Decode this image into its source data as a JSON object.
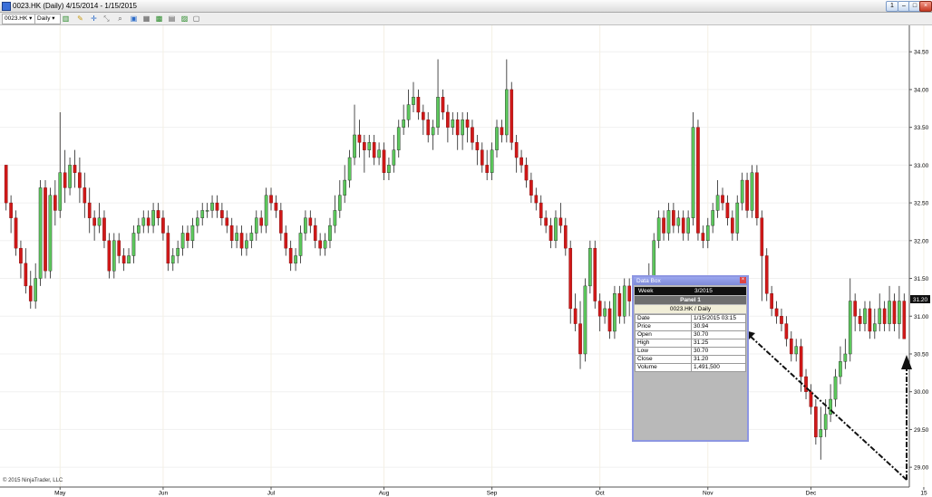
{
  "window": {
    "title": "0023.HK (Daily)  4/15/2014 - 1/15/2015",
    "buttons": [
      "1",
      "–",
      "□",
      "×"
    ]
  },
  "toolbar": {
    "instrument": "0023.HK",
    "interval": "Daily"
  },
  "copyright": "© 2015 NinjaTrader, LLC",
  "chart_data": {
    "type": "candlestick",
    "instrument": "0023.HK",
    "interval": "Daily",
    "ylim": [
      28.75,
      34.85
    ],
    "y_ticks": [
      "34.50",
      "34.00",
      "33.50",
      "33.00",
      "32.50",
      "32.00",
      "31.50",
      "31.00",
      "30.50",
      "30.00",
      "29.50",
      "29.00"
    ],
    "x_ticks": [
      "May",
      "Jun",
      "Jul",
      "Aug",
      "Sep",
      "Oct",
      "Nov",
      "Dec",
      "15"
    ],
    "last_price": "31.20",
    "colors": {
      "up": "#5cc85c",
      "down": "#d01818",
      "wick": "#222222"
    },
    "candles": [
      [
        33.0,
        32.5,
        33.0,
        32.4
      ],
      [
        32.5,
        32.3,
        32.6,
        32.1
      ],
      [
        32.3,
        31.9,
        32.4,
        31.8
      ],
      [
        31.9,
        31.7,
        32.0,
        31.5
      ],
      [
        31.7,
        31.4,
        31.9,
        31.3
      ],
      [
        31.4,
        31.2,
        31.6,
        31.1
      ],
      [
        31.2,
        31.5,
        31.7,
        31.1
      ],
      [
        31.5,
        32.7,
        32.8,
        31.4
      ],
      [
        32.7,
        31.6,
        32.8,
        31.5
      ],
      [
        31.6,
        32.6,
        32.7,
        31.5
      ],
      [
        32.6,
        32.4,
        32.8,
        32.2
      ],
      [
        32.4,
        32.9,
        33.7,
        32.3
      ],
      [
        32.9,
        32.7,
        33.2,
        32.5
      ],
      [
        32.7,
        33.0,
        33.1,
        32.6
      ],
      [
        33.0,
        32.9,
        33.2,
        32.7
      ],
      [
        32.9,
        32.7,
        33.1,
        32.5
      ],
      [
        32.7,
        32.5,
        32.9,
        32.3
      ],
      [
        32.5,
        32.3,
        32.7,
        32.1
      ],
      [
        32.3,
        32.2,
        32.4,
        32.0
      ],
      [
        32.2,
        32.3,
        32.5,
        32.1
      ],
      [
        32.3,
        32.0,
        32.4,
        31.9
      ],
      [
        32.0,
        31.6,
        32.1,
        31.5
      ],
      [
        31.6,
        32.0,
        32.1,
        31.5
      ],
      [
        32.0,
        31.8,
        32.1,
        31.7
      ],
      [
        31.8,
        31.7,
        31.9,
        31.6
      ],
      [
        31.7,
        31.8,
        31.9,
        31.7
      ],
      [
        31.8,
        32.1,
        32.2,
        31.7
      ],
      [
        32.1,
        32.2,
        32.3,
        32.0
      ],
      [
        32.2,
        32.3,
        32.4,
        32.1
      ],
      [
        32.3,
        32.2,
        32.4,
        32.1
      ],
      [
        32.2,
        32.4,
        32.5,
        32.1
      ],
      [
        32.4,
        32.3,
        32.5,
        32.2
      ],
      [
        32.3,
        32.1,
        32.4,
        32.0
      ],
      [
        32.1,
        31.7,
        32.2,
        31.6
      ],
      [
        31.7,
        31.8,
        31.9,
        31.6
      ],
      [
        31.8,
        31.9,
        32.0,
        31.7
      ],
      [
        31.9,
        32.1,
        32.2,
        31.8
      ],
      [
        32.1,
        32.0,
        32.2,
        31.9
      ],
      [
        32.0,
        32.2,
        32.3,
        31.9
      ],
      [
        32.2,
        32.3,
        32.4,
        32.1
      ],
      [
        32.3,
        32.4,
        32.5,
        32.2
      ],
      [
        32.4,
        32.4,
        32.5,
        32.3
      ],
      [
        32.4,
        32.5,
        32.6,
        32.3
      ],
      [
        32.5,
        32.4,
        32.6,
        32.3
      ],
      [
        32.4,
        32.3,
        32.5,
        32.2
      ],
      [
        32.3,
        32.2,
        32.4,
        32.1
      ],
      [
        32.2,
        32.0,
        32.3,
        31.9
      ],
      [
        32.0,
        32.1,
        32.2,
        31.9
      ],
      [
        32.1,
        31.9,
        32.2,
        31.8
      ],
      [
        31.9,
        32.0,
        32.1,
        31.8
      ],
      [
        32.0,
        32.1,
        32.2,
        31.9
      ],
      [
        32.1,
        32.3,
        32.4,
        32.0
      ],
      [
        32.3,
        32.2,
        32.4,
        32.1
      ],
      [
        32.2,
        32.6,
        32.7,
        32.1
      ],
      [
        32.6,
        32.5,
        32.7,
        32.4
      ],
      [
        32.5,
        32.4,
        32.6,
        32.3
      ],
      [
        32.4,
        32.1,
        32.5,
        32.0
      ],
      [
        32.1,
        31.9,
        32.2,
        31.8
      ],
      [
        31.9,
        31.7,
        32.0,
        31.6
      ],
      [
        31.7,
        31.8,
        31.9,
        31.6
      ],
      [
        31.8,
        32.1,
        32.2,
        31.7
      ],
      [
        32.1,
        32.3,
        32.4,
        32.0
      ],
      [
        32.3,
        32.2,
        32.4,
        32.1
      ],
      [
        32.2,
        32.0,
        32.3,
        31.9
      ],
      [
        32.0,
        31.9,
        32.1,
        31.8
      ],
      [
        31.9,
        32.0,
        32.1,
        31.8
      ],
      [
        32.0,
        32.2,
        32.3,
        31.9
      ],
      [
        32.2,
        32.4,
        32.6,
        32.1
      ],
      [
        32.4,
        32.6,
        32.8,
        32.3
      ],
      [
        32.6,
        32.8,
        33.0,
        32.5
      ],
      [
        32.8,
        33.1,
        33.2,
        32.7
      ],
      [
        33.1,
        33.4,
        33.8,
        33.0
      ],
      [
        33.4,
        33.3,
        33.6,
        33.1
      ],
      [
        33.3,
        33.2,
        33.4,
        32.9
      ],
      [
        33.2,
        33.3,
        33.4,
        33.1
      ],
      [
        33.3,
        33.1,
        33.4,
        33.0
      ],
      [
        33.1,
        33.2,
        33.3,
        33.0
      ],
      [
        33.2,
        32.9,
        33.3,
        32.8
      ],
      [
        32.9,
        33.0,
        33.1,
        32.8
      ],
      [
        33.0,
        33.2,
        33.4,
        32.9
      ],
      [
        33.2,
        33.5,
        33.6,
        33.1
      ],
      [
        33.5,
        33.6,
        33.8,
        33.4
      ],
      [
        33.6,
        33.8,
        34.0,
        33.5
      ],
      [
        33.8,
        33.9,
        34.1,
        33.7
      ],
      [
        33.9,
        33.7,
        34.0,
        33.6
      ],
      [
        33.7,
        33.6,
        33.8,
        33.4
      ],
      [
        33.6,
        33.4,
        33.7,
        33.3
      ],
      [
        33.4,
        33.5,
        33.6,
        33.2
      ],
      [
        33.5,
        33.9,
        34.4,
        33.4
      ],
      [
        33.9,
        33.7,
        34.0,
        33.6
      ],
      [
        33.7,
        33.5,
        33.8,
        33.3
      ],
      [
        33.5,
        33.6,
        33.7,
        33.4
      ],
      [
        33.6,
        33.4,
        33.7,
        33.2
      ],
      [
        33.4,
        33.6,
        33.7,
        33.2
      ],
      [
        33.6,
        33.5,
        33.7,
        33.3
      ],
      [
        33.5,
        33.3,
        33.6,
        33.2
      ],
      [
        33.3,
        33.2,
        33.4,
        33.0
      ],
      [
        33.2,
        33.0,
        33.3,
        32.9
      ],
      [
        33.0,
        32.9,
        33.2,
        32.8
      ],
      [
        32.9,
        33.2,
        33.3,
        32.8
      ],
      [
        33.2,
        33.5,
        33.6,
        33.1
      ],
      [
        33.5,
        33.4,
        33.6,
        33.3
      ],
      [
        33.4,
        34.0,
        34.4,
        33.3
      ],
      [
        34.0,
        33.3,
        34.1,
        33.2
      ],
      [
        33.3,
        33.1,
        33.4,
        32.9
      ],
      [
        33.1,
        33.0,
        33.2,
        32.9
      ],
      [
        33.0,
        32.8,
        33.1,
        32.7
      ],
      [
        32.8,
        32.6,
        32.9,
        32.5
      ],
      [
        32.6,
        32.5,
        32.7,
        32.4
      ],
      [
        32.5,
        32.3,
        32.6,
        32.2
      ],
      [
        32.3,
        32.2,
        32.4,
        32.1
      ],
      [
        32.2,
        32.0,
        32.3,
        31.9
      ],
      [
        32.0,
        32.3,
        32.4,
        31.9
      ],
      [
        32.3,
        32.2,
        32.5,
        32.1
      ],
      [
        32.2,
        31.9,
        32.3,
        31.8
      ],
      [
        31.9,
        31.1,
        32.0,
        30.9
      ],
      [
        31.1,
        30.9,
        31.3,
        30.8
      ],
      [
        30.9,
        30.5,
        31.2,
        30.3
      ],
      [
        30.5,
        31.4,
        31.5,
        30.4
      ],
      [
        31.4,
        31.9,
        32.0,
        31.3
      ],
      [
        31.9,
        31.2,
        32.0,
        31.1
      ],
      [
        31.2,
        31.0,
        31.3,
        30.8
      ],
      [
        31.0,
        31.1,
        31.2,
        30.9
      ],
      [
        31.1,
        30.8,
        31.2,
        30.7
      ],
      [
        30.8,
        31.3,
        31.4,
        30.7
      ],
      [
        31.3,
        31.0,
        31.4,
        30.9
      ],
      [
        31.0,
        31.4,
        31.5,
        30.9
      ],
      [
        31.4,
        31.2,
        31.5,
        31.0
      ],
      [
        31.2,
        31.3,
        31.4,
        31.1
      ],
      [
        31.3,
        31.1,
        31.4,
        31.0
      ],
      [
        31.1,
        31.2,
        31.3,
        31.0
      ],
      [
        31.2,
        31.5,
        31.7,
        31.1
      ],
      [
        31.5,
        32.0,
        32.1,
        31.4
      ],
      [
        32.0,
        32.3,
        32.4,
        31.9
      ],
      [
        32.3,
        32.1,
        32.4,
        32.0
      ],
      [
        32.1,
        32.4,
        32.5,
        32.0
      ],
      [
        32.4,
        32.2,
        32.5,
        32.1
      ],
      [
        32.2,
        32.3,
        32.4,
        32.1
      ],
      [
        32.3,
        32.1,
        32.4,
        32.0
      ],
      [
        32.1,
        32.3,
        32.4,
        32.0
      ],
      [
        32.3,
        33.5,
        33.7,
        32.2
      ],
      [
        33.5,
        32.1,
        33.6,
        32.0
      ],
      [
        32.1,
        32.0,
        32.2,
        31.9
      ],
      [
        32.0,
        32.2,
        32.3,
        31.9
      ],
      [
        32.2,
        32.4,
        32.5,
        32.1
      ],
      [
        32.4,
        32.6,
        32.8,
        32.3
      ],
      [
        32.6,
        32.5,
        32.7,
        32.4
      ],
      [
        32.5,
        32.3,
        32.6,
        32.2
      ],
      [
        32.3,
        32.1,
        32.4,
        32.0
      ],
      [
        32.1,
        32.5,
        32.6,
        32.0
      ],
      [
        32.5,
        32.8,
        32.9,
        32.4
      ],
      [
        32.8,
        32.4,
        32.9,
        32.3
      ],
      [
        32.4,
        32.9,
        33.0,
        32.3
      ],
      [
        32.9,
        32.3,
        33.0,
        32.2
      ],
      [
        32.3,
        31.8,
        32.4,
        31.2
      ],
      [
        31.8,
        31.3,
        31.9,
        31.2
      ],
      [
        31.3,
        31.1,
        31.4,
        31.0
      ],
      [
        31.1,
        31.0,
        31.2,
        30.9
      ],
      [
        31.0,
        30.9,
        31.1,
        30.8
      ],
      [
        30.9,
        30.7,
        31.0,
        30.6
      ],
      [
        30.7,
        30.5,
        30.8,
        30.4
      ],
      [
        30.5,
        30.6,
        30.7,
        30.4
      ],
      [
        30.6,
        30.2,
        30.7,
        30.0
      ],
      [
        30.2,
        30.0,
        30.3,
        29.9
      ],
      [
        30.0,
        29.8,
        30.1,
        29.7
      ],
      [
        29.8,
        29.4,
        29.9,
        29.3
      ],
      [
        29.4,
        29.5,
        29.8,
        29.1
      ],
      [
        29.5,
        29.7,
        29.9,
        29.4
      ],
      [
        29.7,
        29.9,
        30.1,
        29.6
      ],
      [
        29.9,
        30.2,
        30.3,
        29.8
      ],
      [
        30.2,
        30.4,
        30.6,
        30.1
      ],
      [
        30.4,
        30.5,
        30.7,
        30.3
      ],
      [
        30.5,
        31.2,
        31.5,
        30.4
      ],
      [
        31.2,
        31.0,
        31.3,
        30.8
      ],
      [
        31.0,
        30.9,
        31.1,
        30.8
      ],
      [
        30.9,
        31.1,
        31.2,
        30.8
      ],
      [
        31.1,
        30.8,
        31.2,
        30.7
      ],
      [
        30.8,
        30.9,
        31.1,
        30.7
      ],
      [
        30.9,
        31.1,
        31.3,
        30.8
      ],
      [
        31.1,
        30.9,
        31.2,
        30.8
      ],
      [
        30.9,
        31.2,
        31.4,
        30.8
      ],
      [
        31.2,
        30.9,
        31.3,
        30.8
      ],
      [
        30.9,
        31.2,
        31.4,
        30.7
      ],
      [
        31.2,
        30.7,
        31.3,
        30.7
      ]
    ]
  },
  "databox": {
    "title": "Data Box",
    "week_label": "Week",
    "week_value": "3/2015",
    "panel": "Panel 1",
    "series": "0023.HK / Daily",
    "rows": [
      {
        "label": "Date",
        "value": "1/15/2015 03:15"
      },
      {
        "label": "Price",
        "value": "30.94"
      },
      {
        "label": "Open",
        "value": "30.70"
      },
      {
        "label": "High",
        "value": "31.25"
      },
      {
        "label": "Low",
        "value": "30.70"
      },
      {
        "label": "Close",
        "value": "31.20"
      },
      {
        "label": "Volume",
        "value": "1,491,500"
      }
    ]
  }
}
